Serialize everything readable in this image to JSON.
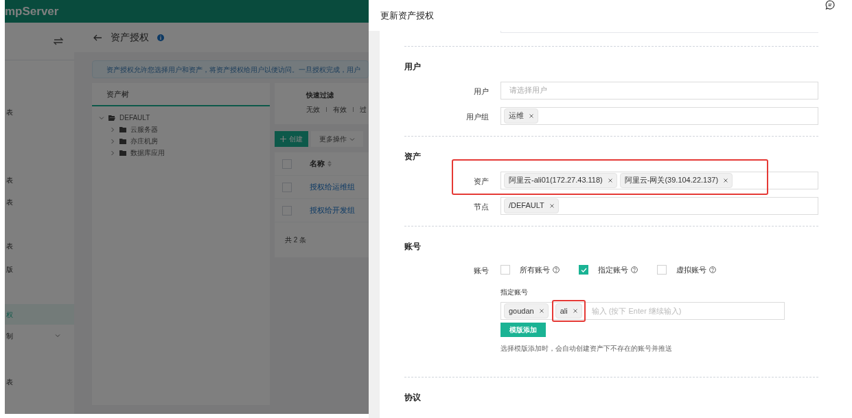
{
  "app": {
    "brand": "mpServer",
    "sidebar": {
      "items": [
        {
          "label": "表",
          "selected": false,
          "expandable": false
        },
        {
          "label": "表",
          "selected": false,
          "expandable": false
        },
        {
          "label": "表",
          "selected": false,
          "expandable": false
        },
        {
          "label": "表",
          "selected": false,
          "expandable": false
        },
        {
          "label": "版",
          "selected": false,
          "expandable": false
        },
        {
          "label": "权",
          "selected": true,
          "expandable": false
        },
        {
          "label": "制",
          "selected": false,
          "expandable": true
        },
        {
          "label": "表",
          "selected": false,
          "expandable": false
        }
      ]
    },
    "page_title": "资产授权",
    "banner": "资产授权允许您选择用户和资产，将资产授权给用户以便访问。一旦授权完成，用户",
    "tree": {
      "title": "资产树",
      "children": [
        {
          "label": "DEFAULT",
          "expanded": true,
          "children": [
            {
              "label": "云服务器",
              "expanded": false
            },
            {
              "label": "亦庄机房",
              "expanded": false
            },
            {
              "label": "数据库应用",
              "expanded": false
            }
          ]
        }
      ]
    },
    "quick_filter": {
      "title": "快速过滤",
      "options": [
        "无效",
        "有效",
        "过"
      ]
    },
    "toolbar": {
      "create": "创建",
      "more": "更多操作"
    },
    "table": {
      "select_all": false,
      "columns": [
        "名称"
      ],
      "rows": [
        {
          "name": "授权给运维组",
          "checked": false
        },
        {
          "name": "授权给开发组",
          "checked": false
        }
      ],
      "total": "共 2 条"
    }
  },
  "drawer": {
    "title": "更新资产授权",
    "sections": [
      {
        "heading": "用户",
        "fields": [
          {
            "label": "用户",
            "placeholder": "请选择用户",
            "highlighted": false
          },
          {
            "label": "用户组",
            "tags": [
              {
                "text": "运维"
              }
            ],
            "highlighted": false
          }
        ]
      },
      {
        "heading": "资产",
        "fields": [
          {
            "label": "资产",
            "tags": [
              {
                "text": "阿里云-ali01(172.27.43.118)"
              },
              {
                "text": "阿里云-网关(39.104.22.137)"
              }
            ],
            "highlighted": true
          },
          {
            "label": "节点",
            "tags": [
              {
                "text": "/DEFAULT"
              }
            ],
            "highlighted": false
          }
        ]
      },
      {
        "heading": "账号",
        "accounts": {
          "label": "账号",
          "options": [
            {
              "label": "所有账号",
              "checked": false
            },
            {
              "label": "指定账号",
              "checked": true
            },
            {
              "label": "虚拟账号",
              "checked": false
            }
          ],
          "specified_label": "指定账号",
          "tags": [
            {
              "text": "goudan",
              "highlighted": false
            },
            {
              "text": "ali",
              "highlighted": true
            }
          ],
          "placeholder": "输入 (按下 Enter 继续输入)",
          "template_button": "模版添加",
          "hint": "选择模版添加时，会自动创建资产下不存在的账号并推送"
        }
      },
      {
        "heading": "协议"
      }
    ]
  }
}
